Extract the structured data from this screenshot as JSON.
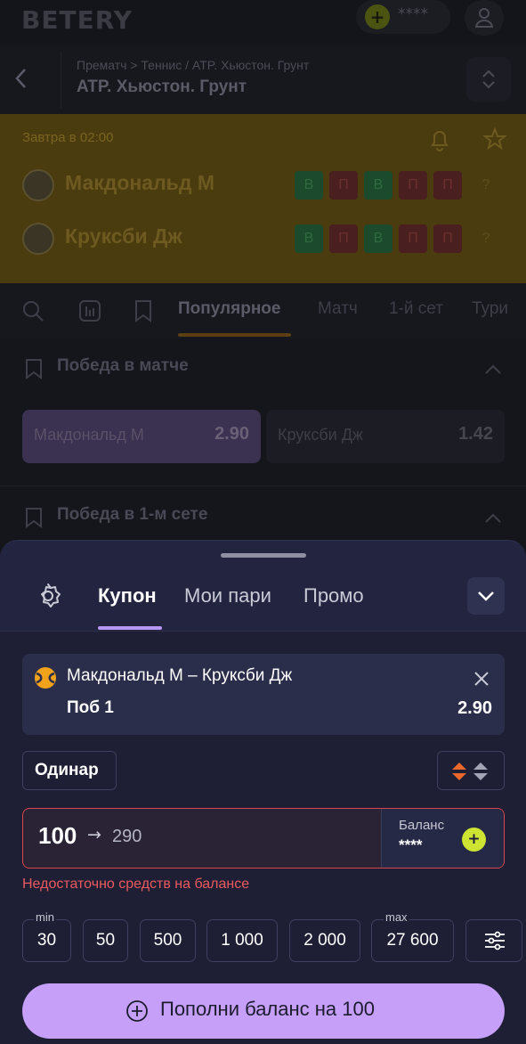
{
  "header": {
    "logo": "BETERY",
    "balance_masked": "****"
  },
  "breadcrumb": {
    "path": "Прематч > Теннис / ATP. Хьюстон. Грунт",
    "title": "ATP. Хьюстон. Грунт"
  },
  "match": {
    "time": "Завтра в 02:00",
    "teams": [
      {
        "name": "Макдональд М",
        "form": [
          "В",
          "П",
          "В",
          "П",
          "П"
        ],
        "extra": "?"
      },
      {
        "name": "Круксби Дж",
        "form": [
          "В",
          "П",
          "В",
          "П",
          "П"
        ],
        "extra": "?"
      }
    ]
  },
  "tabs": [
    "Популярное",
    "Матч",
    "1-й сет",
    "Тури"
  ],
  "markets": [
    {
      "title": "Победа в матче",
      "odds": [
        {
          "name": "Макдональд М",
          "value": "2.90"
        },
        {
          "name": "Круксби Дж",
          "value": "1.42"
        }
      ]
    },
    {
      "title": "Победа в 1-м сете"
    }
  ],
  "coupon": {
    "tabs": [
      "Купон",
      "Мои пари",
      "Промо"
    ],
    "bet": {
      "match": "Макдональд М – Круксби Дж",
      "outcome": "Поб 1",
      "odd": "2.90"
    },
    "bet_type": "Одинар",
    "stake": {
      "value": "100",
      "arrow": "→",
      "win": "290",
      "balance_label": "Баланс",
      "balance_value": "****"
    },
    "error": "Недостаточно средств на балансе",
    "chips": [
      {
        "label": "30",
        "tag": "min"
      },
      {
        "label": "50"
      },
      {
        "label": "500"
      },
      {
        "label": "1 000"
      },
      {
        "label": "2 000"
      },
      {
        "label": "27 600",
        "tag": "max"
      }
    ],
    "cta": "Пополни баланс на 100"
  },
  "colors": {
    "accent": "#c59ff8",
    "error": "#ec5a5f",
    "balance_add": "#cde433"
  }
}
